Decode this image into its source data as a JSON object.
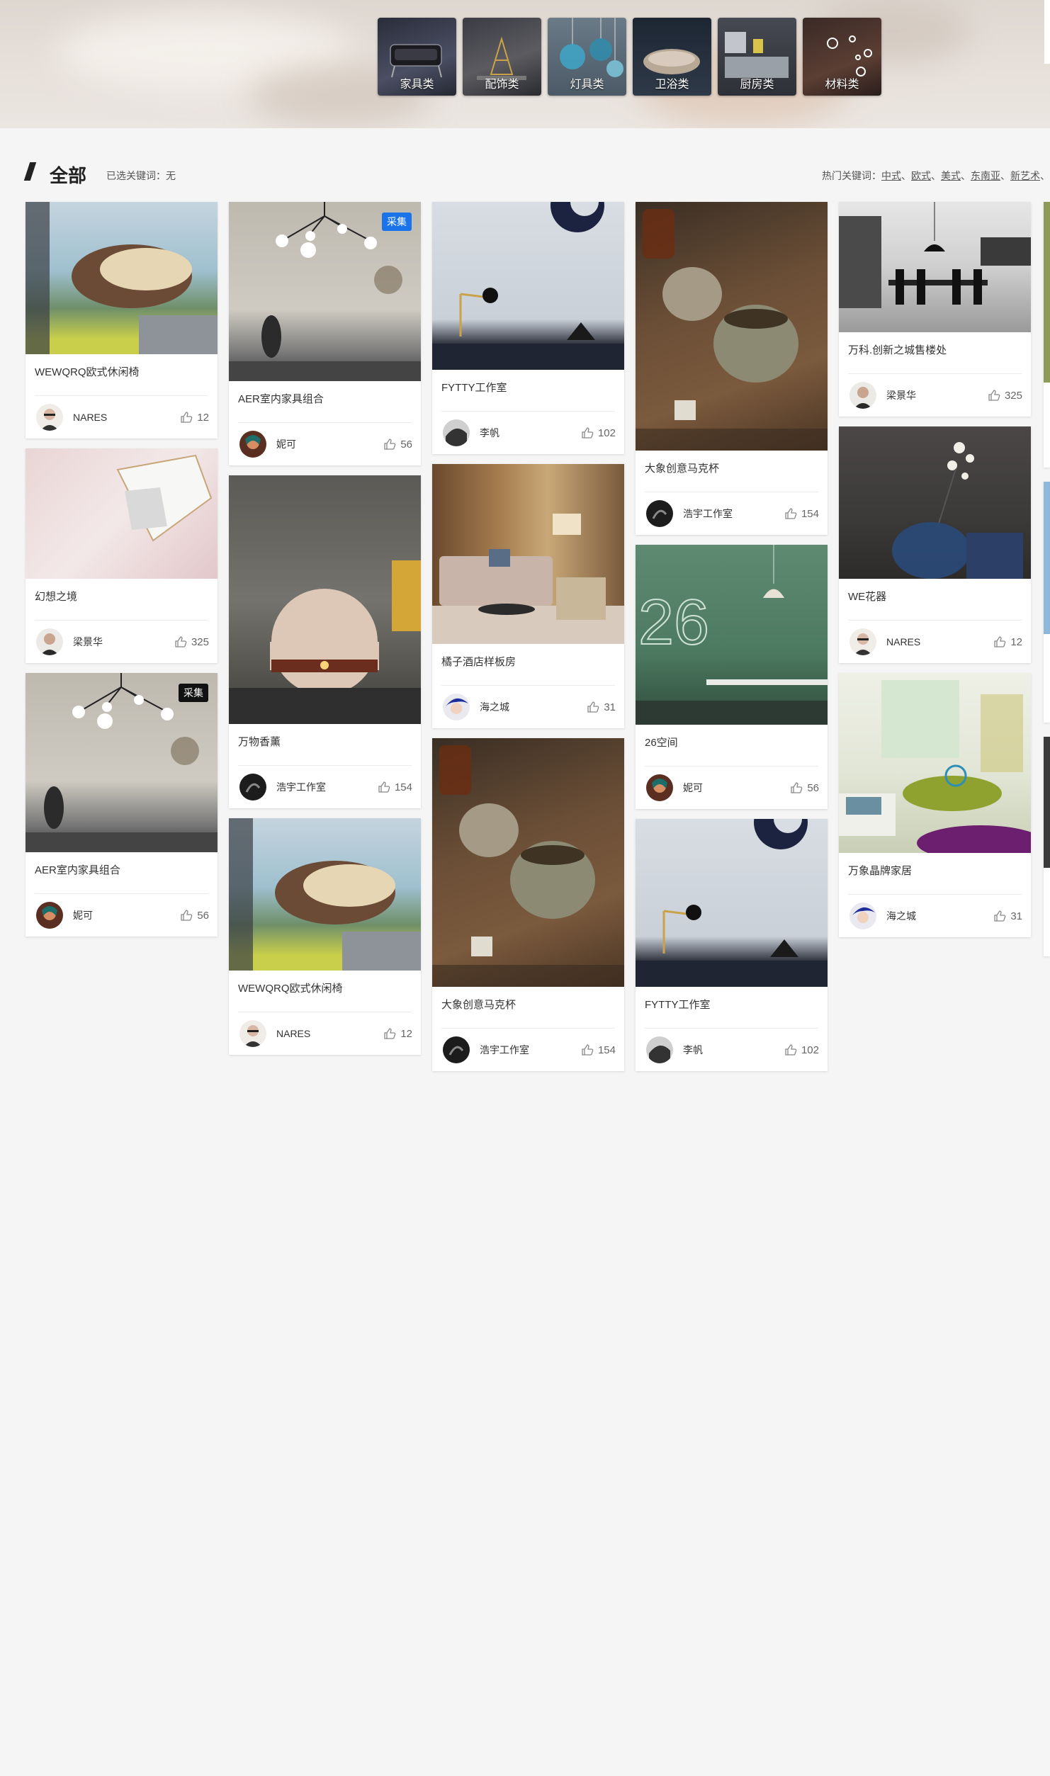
{
  "categories": [
    {
      "label": "家具类",
      "icon": "furniture-thumbnail"
    },
    {
      "label": "配饰类",
      "icon": "accessory-thumbnail"
    },
    {
      "label": "灯具类",
      "icon": "lamp-thumbnail"
    },
    {
      "label": "卫浴类",
      "icon": "bath-thumbnail"
    },
    {
      "label": "厨房类",
      "icon": "kitchen-thumbnail"
    },
    {
      "label": "材料类",
      "icon": "material-thumbnail"
    }
  ],
  "section": {
    "title": "全部",
    "selected_keywords": "已选关键词：无",
    "hot_label": "热门关键词：",
    "hot_keywords": [
      "中式",
      "欧式",
      "美式",
      "东南亚",
      "新艺术"
    ],
    "separator": "、"
  },
  "badge_label": "采集",
  "cards": {
    "c1a": {
      "title": "WEWQRQ欧式休闲椅",
      "author": "NARES",
      "likes": "12"
    },
    "c1b": {
      "title": "幻想之境",
      "author": "梁景华",
      "likes": "325"
    },
    "c1c": {
      "title": "AER室内家具组合",
      "author": "妮可",
      "likes": "56"
    },
    "c2a": {
      "title": "AER室内家具组合",
      "author": "妮可",
      "likes": "56"
    },
    "c2b": {
      "title": "万物香薰",
      "author": "浩宇工作室",
      "likes": "154"
    },
    "c2c": {
      "title": "WEWQRQ欧式休闲椅",
      "author": "NARES",
      "likes": "12"
    },
    "c3a": {
      "title": "FYTTY工作室",
      "author": "李帆",
      "likes": "102"
    },
    "c3b": {
      "title": "橘子酒店样板房",
      "author": "海之城",
      "likes": "31"
    },
    "c3c": {
      "title": "大象创意马克杯",
      "author": "浩宇工作室",
      "likes": "154"
    },
    "c4a": {
      "title": "大象创意马克杯",
      "author": "浩宇工作室",
      "likes": "154"
    },
    "c4b": {
      "title": "26空间",
      "author": "妮可",
      "likes": "56"
    },
    "c4c": {
      "title": "FYTTY工作室",
      "author": "李帆",
      "likes": "102"
    },
    "c5a": {
      "title": "万科.创新之城售楼处",
      "author": "梁景华",
      "likes": "325"
    },
    "c5b": {
      "title": "WE花器",
      "author": "NARES",
      "likes": "12"
    },
    "c5c": {
      "title": "万象晶牌家居",
      "author": "海之城",
      "likes": "31"
    }
  },
  "colors": {
    "badge_blue": "#1a73e8",
    "badge_black": "#111111",
    "page_bg": "#f5f5f5"
  }
}
